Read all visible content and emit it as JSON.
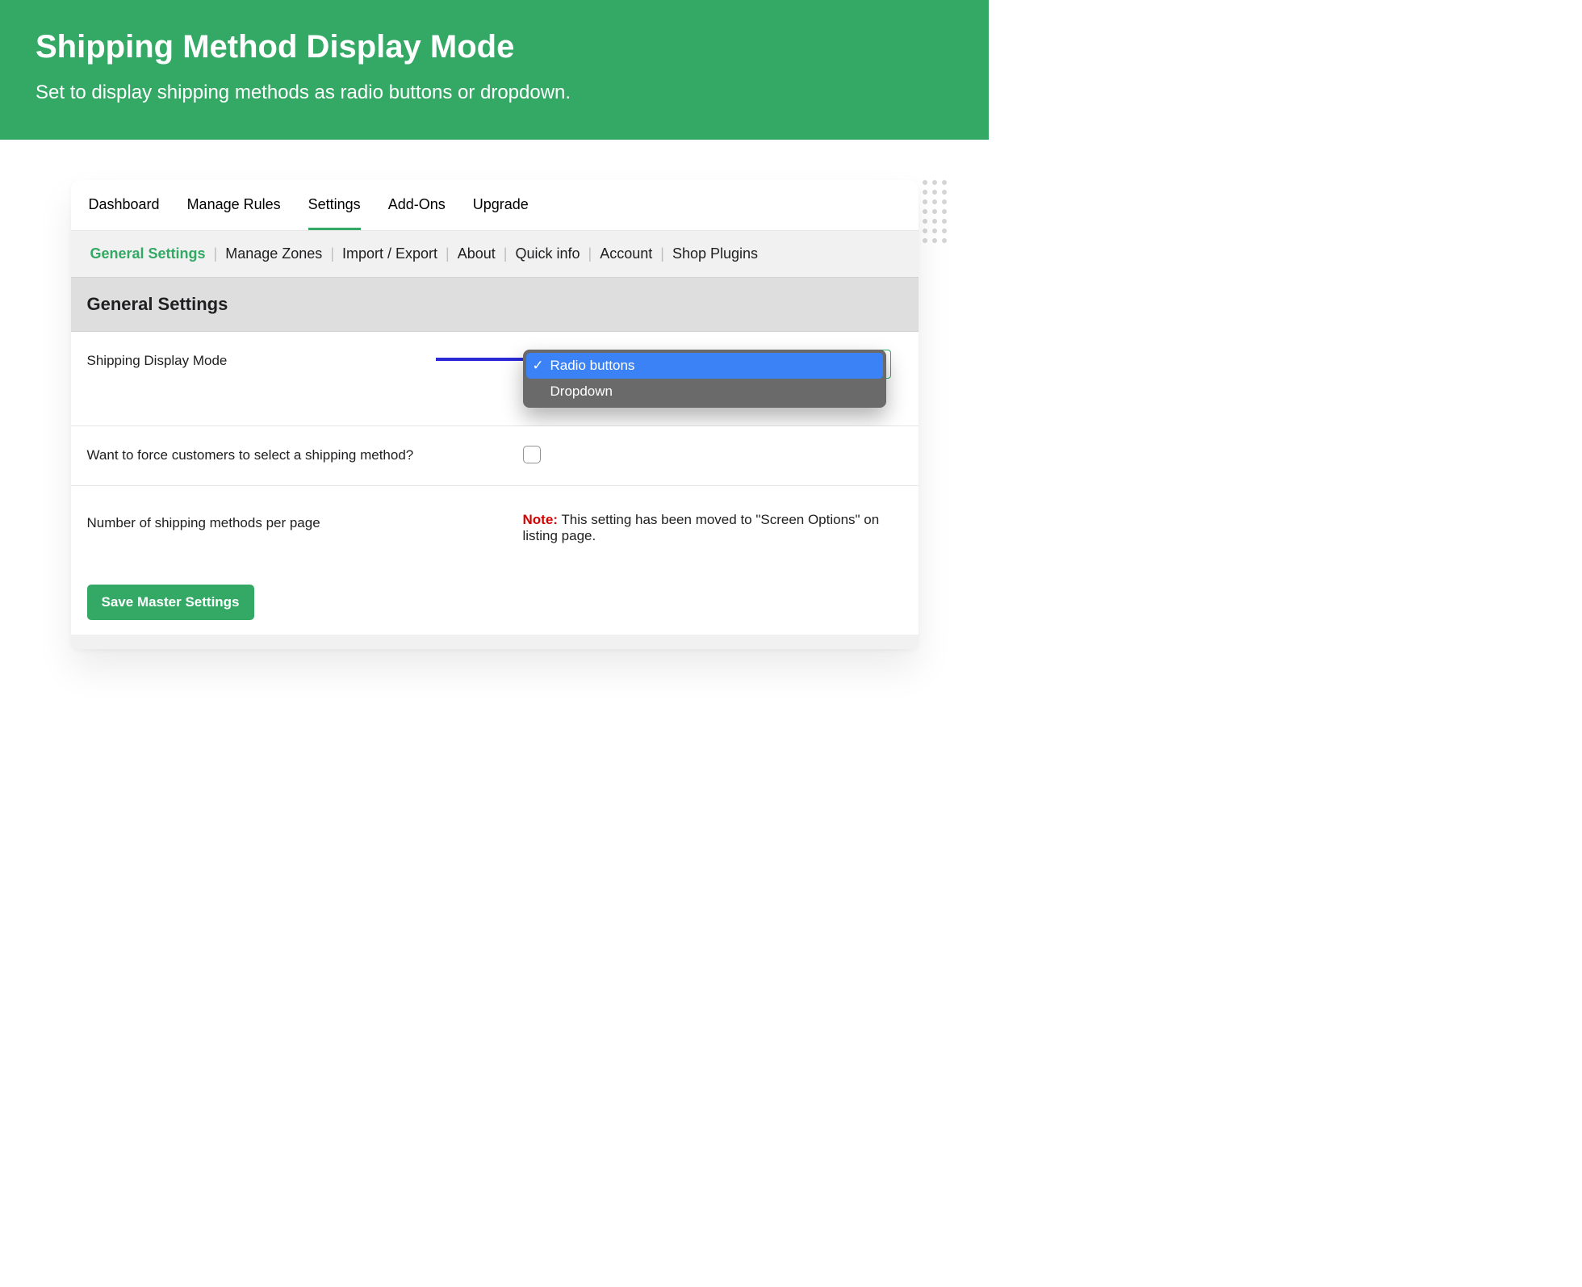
{
  "hero": {
    "title": "Shipping Method Display Mode",
    "subtitle": "Set to display shipping methods as radio buttons or dropdown."
  },
  "top_tabs": [
    {
      "label": "Dashboard",
      "active": false
    },
    {
      "label": "Manage Rules",
      "active": false
    },
    {
      "label": "Settings",
      "active": true
    },
    {
      "label": "Add-Ons",
      "active": false
    },
    {
      "label": "Upgrade",
      "active": false
    }
  ],
  "sub_tabs": [
    {
      "label": "General Settings",
      "active": true
    },
    {
      "label": "Manage Zones",
      "active": false
    },
    {
      "label": "Import / Export",
      "active": false
    },
    {
      "label": "About",
      "active": false
    },
    {
      "label": "Quick info",
      "active": false
    },
    {
      "label": "Account",
      "active": false
    },
    {
      "label": "Shop Plugins",
      "active": false
    }
  ],
  "section": {
    "title": "General Settings"
  },
  "rows": {
    "display_mode": {
      "label": "Shipping Display Mode",
      "options": [
        {
          "label": "Radio buttons",
          "selected": true
        },
        {
          "label": "Dropdown",
          "selected": false
        }
      ]
    },
    "force_select": {
      "label": "Want to force customers to select a shipping method?",
      "checked": false
    },
    "per_page": {
      "label": "Number of shipping methods per page",
      "note_label": "Note:",
      "note_text": " This setting has been moved to \"Screen Options\" on listing page."
    }
  },
  "buttons": {
    "save": "Save Master Settings"
  },
  "colors": {
    "brand": "#33a965",
    "accent_blue": "#3b82f6",
    "arrow_blue": "#2929d6"
  }
}
